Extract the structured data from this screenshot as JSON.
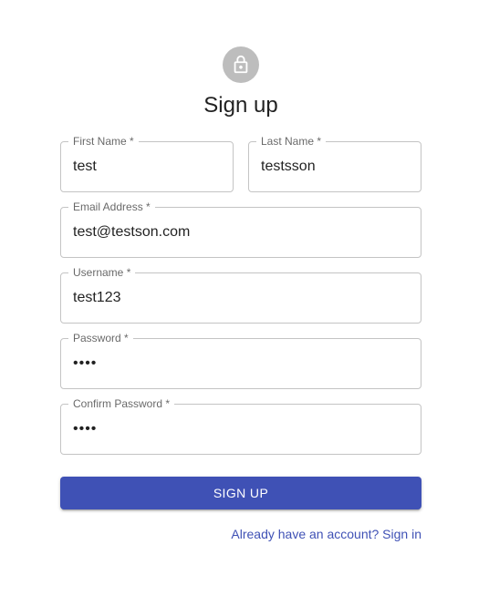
{
  "header": {
    "avatar_icon": "lock-outlined-icon",
    "avatar_color": "#bdbdbd",
    "title": "Sign up"
  },
  "form": {
    "first_name": {
      "label": "First Name *",
      "value": "test"
    },
    "last_name": {
      "label": "Last Name *",
      "value": "testsson"
    },
    "email": {
      "label": "Email Address *",
      "value": "test@testson.com"
    },
    "username": {
      "label": "Username *",
      "value": "test123"
    },
    "password": {
      "label": "Password *",
      "value": "••••"
    },
    "confirm_password": {
      "label": "Confirm Password *",
      "value": "••••"
    }
  },
  "actions": {
    "submit_label": "SIGN UP",
    "submit_color": "#3f51b5",
    "signin_link": "Already have an account? Sign in"
  }
}
